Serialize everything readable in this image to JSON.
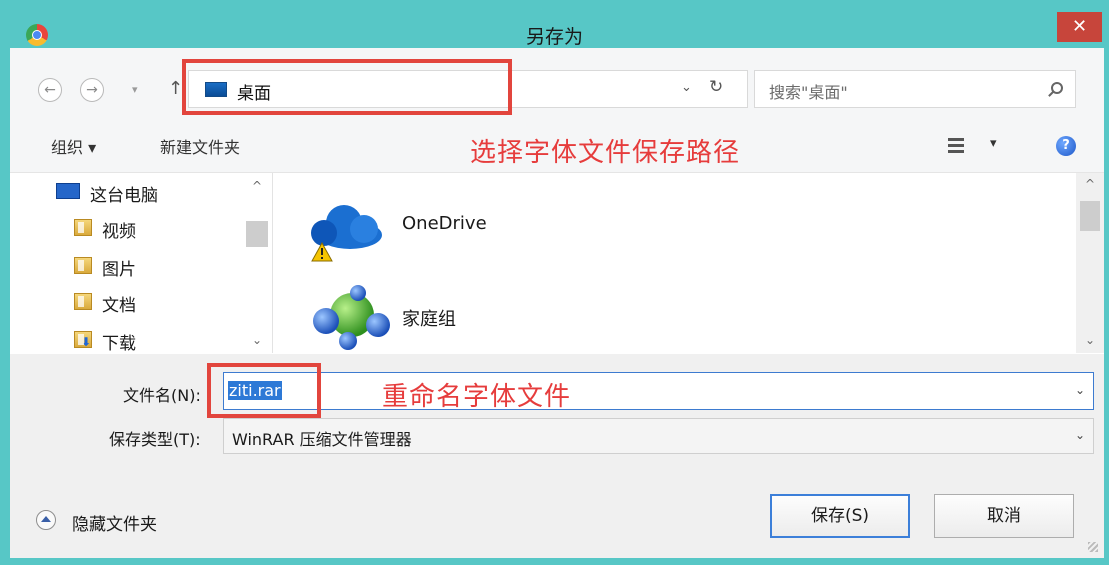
{
  "window": {
    "title": "另存为",
    "close_label": "✕"
  },
  "nav": {
    "back": "←",
    "forward": "→",
    "recent": "▾",
    "up": "↑"
  },
  "address": {
    "location": "桌面",
    "chevron": "⌄",
    "refresh": "↻"
  },
  "search": {
    "placeholder": "搜索\"桌面\""
  },
  "command_bar": {
    "organize": "组织 ▾",
    "new_folder": "新建文件夹",
    "view_arrow": "▾",
    "help": "?"
  },
  "annotations": {
    "path_hint": "选择字体文件保存路径",
    "rename_hint": "重命名字体文件"
  },
  "nav_pane": {
    "items": [
      {
        "label": "这台电脑",
        "icon": "computer-icon"
      },
      {
        "label": "视频",
        "icon": "video-folder-icon"
      },
      {
        "label": "图片",
        "icon": "pictures-folder-icon"
      },
      {
        "label": "文档",
        "icon": "documents-folder-icon"
      },
      {
        "label": "下载",
        "icon": "downloads-folder-icon"
      }
    ],
    "scroll_up": "^",
    "scroll_down": "⌄"
  },
  "files": [
    {
      "label": "OneDrive",
      "icon": "onedrive-cloud-icon"
    },
    {
      "label": "家庭组",
      "icon": "homegroup-icon"
    }
  ],
  "file_scroll": {
    "up": "^",
    "down": "⌄"
  },
  "filename": {
    "label": "文件名(N):",
    "value": "ziti.rar",
    "chevron": "⌄"
  },
  "filetype": {
    "label": "保存类型(T):",
    "value": "WinRAR 压缩文件管理器",
    "chevron": "⌄"
  },
  "footer": {
    "hide_folders": "隐藏文件夹",
    "save": "保存(S)",
    "cancel": "取消"
  },
  "colors": {
    "frame": "#57c7c6",
    "close": "#c7453b",
    "annotation": "#e2453d",
    "selection": "#2d79d6"
  }
}
